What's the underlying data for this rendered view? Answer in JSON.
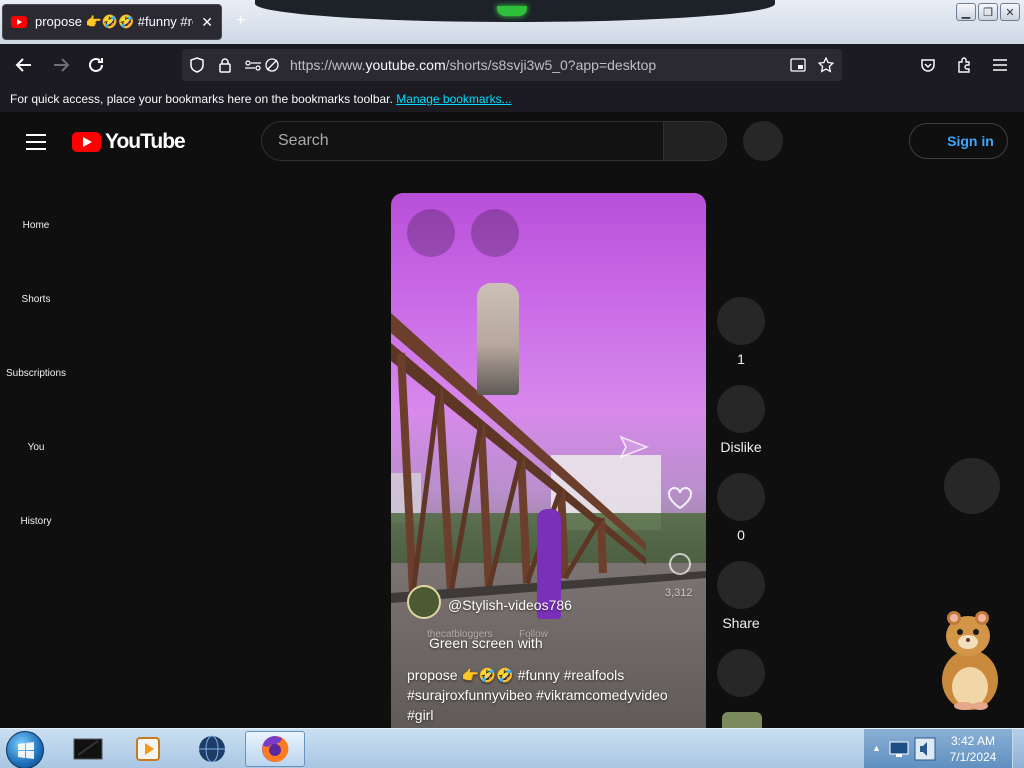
{
  "browser": {
    "tab_title": "propose 👉🤣🤣 #funny #realfoo",
    "tab_close": "✕",
    "new_tab": "+",
    "window_buttons": [
      "▁",
      "❐",
      "✕"
    ],
    "url_prefix": "https://www.",
    "url_domain": "youtube.com",
    "url_path": "/shorts/s8svji3w5_0?app=desktop",
    "bookmarks_text": "For quick access, place your bookmarks here on the bookmarks toolbar.",
    "bookmarks_link": "Manage bookmarks..."
  },
  "youtube": {
    "logo_text": "YouTube",
    "search_placeholder": "Search",
    "sign_in": "Sign in",
    "sidebar": [
      "Home",
      "Shorts",
      "Subscriptions",
      "You",
      "History"
    ]
  },
  "short": {
    "channel": "@Stylish-videos786",
    "title_line1": "Green screen with",
    "title_line2": "propose 👉🤣🤣 #funny #realfools",
    "title_line3": "#surajroxfunnyvibeo #vikramcomedyvideo",
    "title_line4": "#girl",
    "overlay_count": "3,312",
    "overlay_channel": "thecatbloggers",
    "overlay_follow": "Follow"
  },
  "actions": {
    "like_count": "1",
    "dislike_label": "Dislike",
    "comment_count": "0",
    "share_label": "Share"
  },
  "taskbar": {
    "time": "3:42 AM",
    "date": "7/1/2024"
  }
}
